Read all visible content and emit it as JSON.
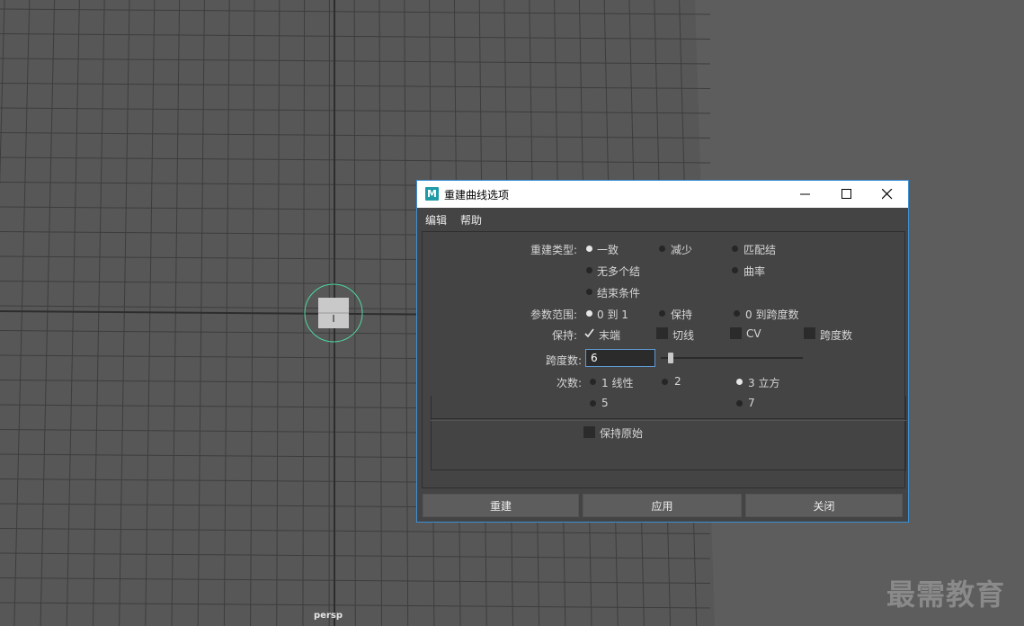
{
  "viewport": {
    "camera_label": "persp"
  },
  "watermark": "最需教育",
  "dialog": {
    "title": "重建曲线选项",
    "app_icon_letter": "M",
    "menu": [
      "编辑",
      "帮助"
    ],
    "rebuild_type": {
      "label": "重建类型:",
      "options": [
        "一致",
        "减少",
        "匹配结",
        "无多个结",
        "曲率",
        "结束条件"
      ],
      "selected": "一致"
    },
    "param_range": {
      "label": "参数范围:",
      "options": [
        "0 到 1",
        "保持",
        "0 到跨度数"
      ],
      "selected": "0 到 1"
    },
    "keep": {
      "label": "保持:",
      "options": [
        "末端",
        "切线",
        "CV",
        "跨度数"
      ],
      "checked": [
        "末端"
      ]
    },
    "spans": {
      "label": "跨度数:",
      "value": "6"
    },
    "degree": {
      "label": "次数:",
      "options": [
        "1 线性",
        "2",
        "3 立方",
        "5",
        "7"
      ],
      "selected": "3 立方"
    },
    "keep_original": {
      "label": "保持原始",
      "checked": false
    },
    "buttons": {
      "rebuild": "重建",
      "apply": "应用",
      "close": "关闭"
    },
    "colors": {
      "title_bg": "#ffffff",
      "border": "#3c8fd6",
      "body_bg": "#444444"
    }
  }
}
